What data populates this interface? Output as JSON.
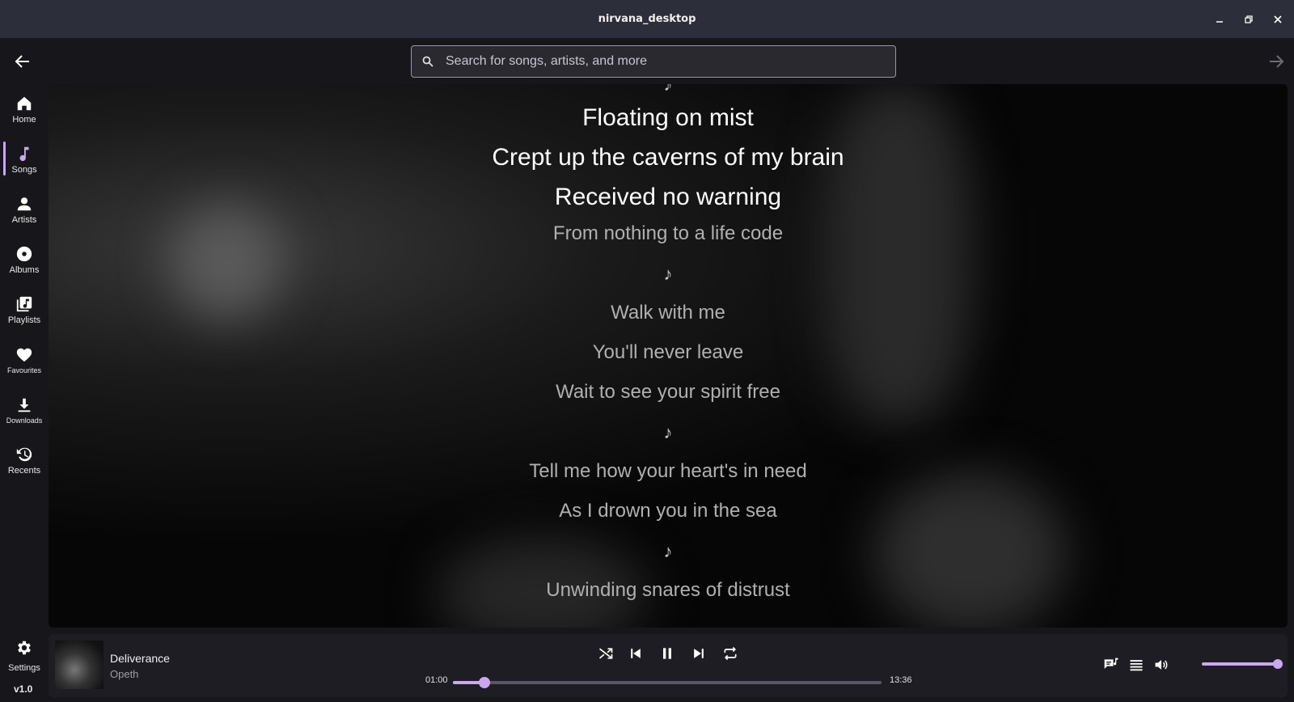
{
  "window": {
    "title": "nirvana_desktop"
  },
  "search": {
    "placeholder": "Search for songs, artists, and more"
  },
  "sidebar": {
    "items": [
      {
        "label": "Home",
        "icon": "home-icon"
      },
      {
        "label": "Songs",
        "icon": "music-note-icon",
        "active": true
      },
      {
        "label": "Artists",
        "icon": "person-icon"
      },
      {
        "label": "Albums",
        "icon": "disc-icon"
      },
      {
        "label": "Playlists",
        "icon": "playlist-icon"
      },
      {
        "label": "Favourites",
        "icon": "heart-icon"
      },
      {
        "label": "Downloads",
        "icon": "download-icon"
      },
      {
        "label": "Recents",
        "icon": "history-icon"
      }
    ],
    "settings_label": "Settings",
    "version": "v1.0"
  },
  "lyrics": {
    "lines": [
      {
        "text": "♪",
        "style": "note"
      },
      {
        "text": "Floating on mist",
        "style": "hi"
      },
      {
        "text": "Crept up the caverns of my brain",
        "style": "hi"
      },
      {
        "text": "Received no warning",
        "style": "hi"
      },
      {
        "text": "From nothing to a life code",
        "style": "lo"
      },
      {
        "text": "♪",
        "style": "note"
      },
      {
        "text": "Walk with me",
        "style": "lo"
      },
      {
        "text": "You'll never leave",
        "style": "lo"
      },
      {
        "text": "Wait to see your spirit free",
        "style": "lo"
      },
      {
        "text": "♪",
        "style": "note"
      },
      {
        "text": "Tell me how your heart's in need",
        "style": "lo"
      },
      {
        "text": "As I drown you in the sea",
        "style": "lo"
      },
      {
        "text": "♪",
        "style": "note"
      },
      {
        "text": "Unwinding snares of distrust",
        "style": "lo"
      }
    ]
  },
  "player": {
    "track_title": "Deliverance",
    "artist": "Opeth",
    "elapsed": "01:00",
    "duration": "13:36",
    "progress_fraction": 0.074,
    "volume_fraction": 1.0,
    "accent_color": "#c9a8f0"
  }
}
